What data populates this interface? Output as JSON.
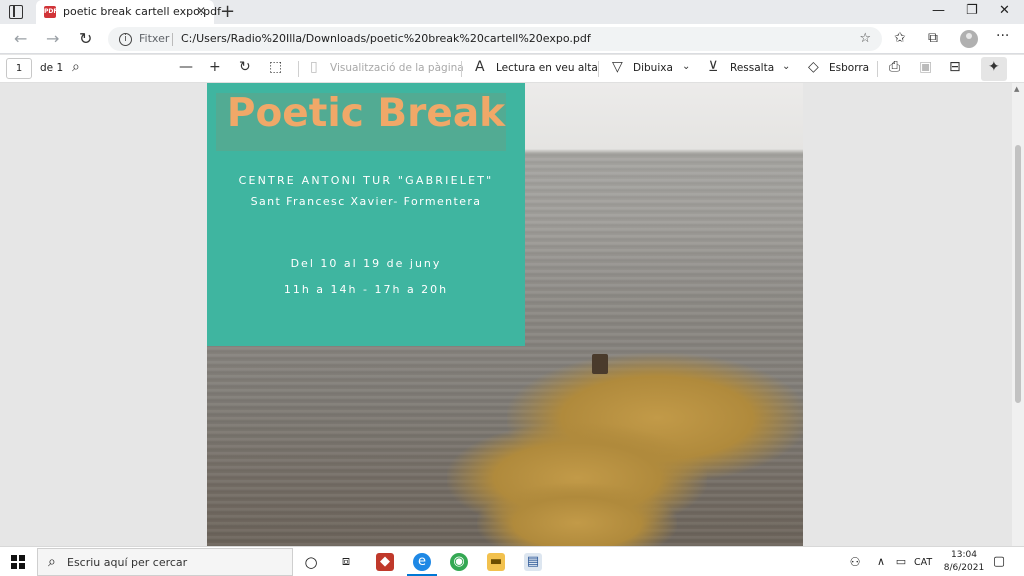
{
  "browser": {
    "tab_title": "poetic break cartell expo.pdf",
    "tab_icon": "pdf-file-icon",
    "new_tab": "+",
    "url_label": "Fitxer",
    "url": "C:/Users/Radio%20Illa/Downloads/poetic%20break%20cartell%20expo.pdf"
  },
  "pdf_toolbar": {
    "page_number": "1",
    "page_total": "de 1",
    "page_view": "Visualització de la pàgina",
    "read_aloud": "Lectura en veu alta",
    "draw": "Dibuixa",
    "highlight": "Ressalta",
    "erase": "Esborra"
  },
  "poster": {
    "title": "Poetic Break",
    "venue": "CENTRE ANTONI TUR \"GABRIELET\"",
    "location": "Sant Francesc Xavier- Formentera",
    "dates": "Del 10 al 19 de juny",
    "hours": "11h a 14h - 17h a 20h"
  },
  "taskbar": {
    "search_placeholder": "Escriu aquí per cercar",
    "language": "CAT",
    "time": "13:04",
    "date": "8/6/2021"
  },
  "colors": {
    "poster_box": "#3fb5a0",
    "poster_title": "#f0a868",
    "accent": "#0078d4"
  }
}
